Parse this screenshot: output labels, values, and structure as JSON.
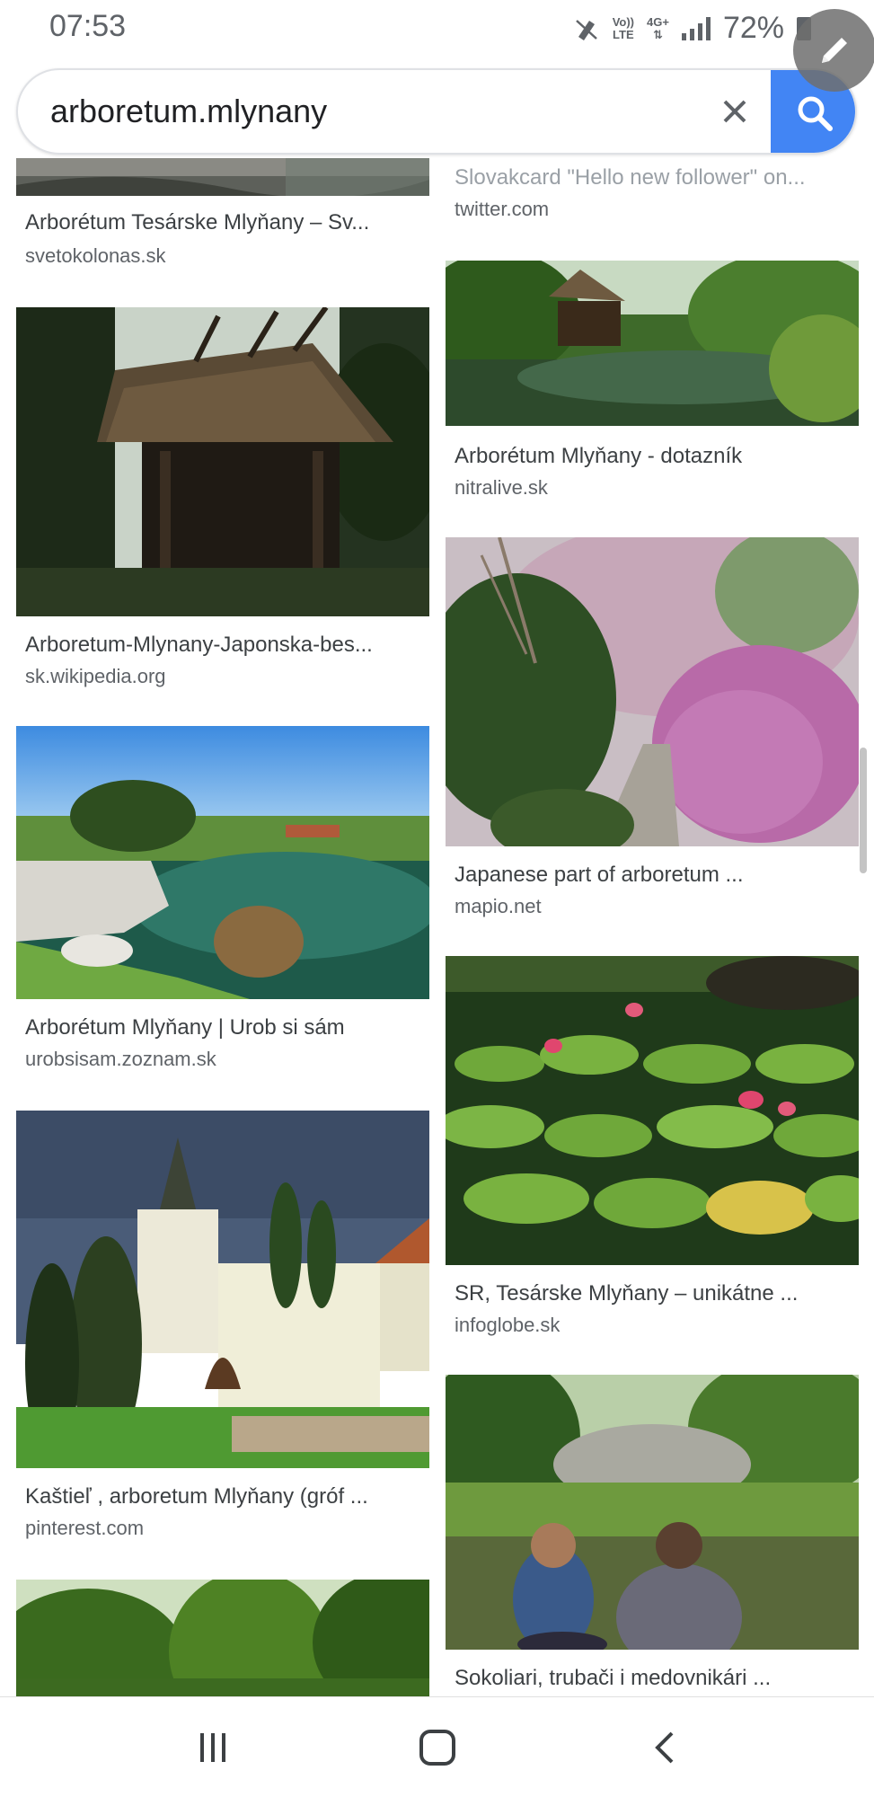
{
  "status": {
    "time": "07:53",
    "network_top": "Vo))",
    "network_bottom": "LTE",
    "data_type": "4G+",
    "battery_percent": "72%"
  },
  "search": {
    "query": "arboretum.mlynany",
    "placeholder": "Search"
  },
  "results": [
    {
      "title": "Arborétum Tesárske Mlyňany – Sv...",
      "source": "svetokolonas.sk"
    },
    {
      "title": "Slovakcard \"Hello new follower\" on...",
      "source": "twitter.com"
    },
    {
      "title": "Arboretum-Mlynany-Japonska-bes...",
      "source": "sk.wikipedia.org"
    },
    {
      "title": "Arborétum Mlyňany - dotazník",
      "source": "nitralive.sk"
    },
    {
      "title": "Arborétum Mlyňany | Urob si sám",
      "source": "urobsisam.zoznam.sk"
    },
    {
      "title": "Japanese part of arboretum ...",
      "source": "mapio.net"
    },
    {
      "title": "Kaštieľ , arboretum Mlyňany (gróf ...",
      "source": "pinterest.com"
    },
    {
      "title": "SR, Tesárske Mlyňany – unikátne ...",
      "source": "infoglobe.sk"
    },
    {
      "title": "Sokoliari, trubači i medovnikári ...",
      "source": ""
    }
  ],
  "colors": {
    "accent": "#4285f4",
    "muted": "#5f6368"
  },
  "icons": [
    "pencil-icon",
    "clear-icon",
    "search-icon",
    "recent-apps-icon",
    "home-icon",
    "back-icon"
  ]
}
